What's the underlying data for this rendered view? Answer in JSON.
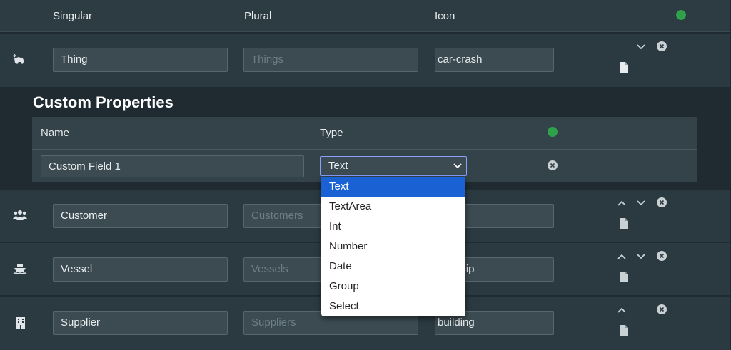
{
  "header": {
    "singular_label": "Singular",
    "plural_label": "Plural",
    "icon_label": "Icon"
  },
  "entities": [
    {
      "icon": "car-crash-icon",
      "singular": "Thing",
      "plural": "Things",
      "icon_value": "car-crash"
    },
    {
      "icon": "users-icon",
      "singular": "Customer",
      "plural": "Customers",
      "icon_value": ""
    },
    {
      "icon": "ship-icon",
      "singular": "Vessel",
      "plural": "Vessels",
      "icon_value": "ship"
    },
    {
      "icon": "building-icon",
      "singular": "Supplier",
      "plural": "Suppliers",
      "icon_value": "building"
    }
  ],
  "custom_properties": {
    "title": "Custom Properties",
    "name_label": "Name",
    "type_label": "Type",
    "fields": [
      {
        "name": "Custom Field 1",
        "type": "Text"
      }
    ]
  },
  "type_dropdown": {
    "options": [
      "Text",
      "TextArea",
      "Int",
      "Number",
      "Date",
      "Group",
      "Select"
    ],
    "selected": "Text"
  },
  "colors": {
    "accent_add": "#2fa14a",
    "selected_option": "#1a62d4"
  }
}
